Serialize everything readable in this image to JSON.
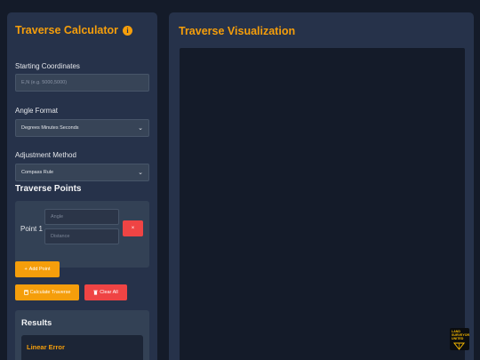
{
  "calculator": {
    "title": "Traverse Calculator",
    "info_icon": "info-icon",
    "starting_coordinates_label": "Starting Coordinates",
    "starting_coordinates_placeholder": "E,N (e.g. 5000,5000)",
    "starting_coordinates_value": "",
    "angle_format_label": "Angle Format",
    "angle_format_selected": "Degrees Minutes Seconds",
    "adjustment_method_label": "Adjustment Method",
    "adjustment_method_selected": "Compass Rule",
    "traverse_points_heading": "Traverse Points",
    "points": [
      {
        "label": "Point 1",
        "angle_placeholder": "Angle",
        "distance_placeholder": "Distance",
        "remove_label": "×"
      }
    ],
    "add_point_label": "Add Point",
    "calculate_label": "Calculate Traverse",
    "clear_label": "Clear All",
    "results_heading": "Results",
    "linear_error_heading": "Linear Error"
  },
  "visualization": {
    "title": "Traverse Visualization"
  },
  "logo": {
    "text": "LAND SURVEYORS UNITED"
  },
  "colors": {
    "background": "#141b29",
    "panel": "#26324a",
    "accent": "#f59e0b",
    "danger": "#ef4444"
  }
}
